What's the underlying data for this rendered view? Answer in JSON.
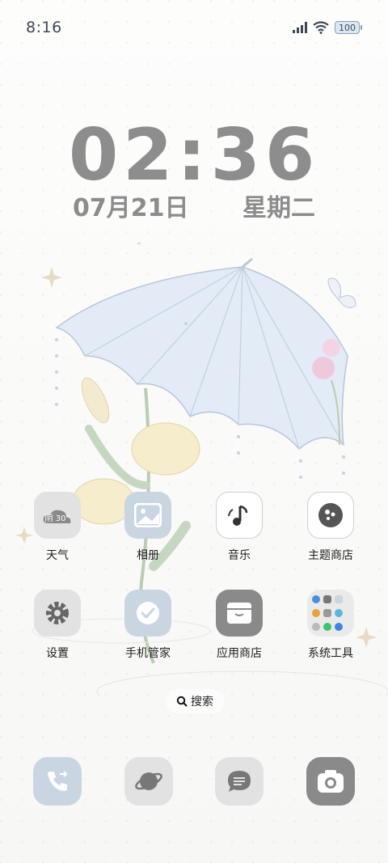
{
  "status_bar": {
    "time": "8:16",
    "battery": "100",
    "signal_icon": "signal-icon",
    "wifi_icon": "wifi-icon"
  },
  "clock": {
    "time": "02:36",
    "date": "07月21日",
    "weekday": "星期二"
  },
  "weather_widget_text": "阴 30°",
  "apps": [
    {
      "label": "天气",
      "icon": "weather-icon"
    },
    {
      "label": "相册",
      "icon": "gallery-icon"
    },
    {
      "label": "音乐",
      "icon": "music-icon"
    },
    {
      "label": "主题商店",
      "icon": "theme-store-icon"
    },
    {
      "label": "设置",
      "icon": "gear-icon"
    },
    {
      "label": "手机管家",
      "icon": "phone-manager-icon"
    },
    {
      "label": "应用商店",
      "icon": "app-store-icon"
    },
    {
      "label": "系统工具",
      "icon": "folder-icon"
    }
  ],
  "search": {
    "label": "搜索",
    "icon": "search-icon"
  },
  "dock": [
    {
      "icon": "phone-icon"
    },
    {
      "icon": "browser-icon"
    },
    {
      "icon": "message-icon"
    },
    {
      "icon": "camera-icon"
    }
  ],
  "colors": {
    "icon_gray": "#e6e6e6",
    "icon_blue": "#c9d6e2",
    "icon_dark": "#8a8a8a",
    "text": "#222222"
  }
}
